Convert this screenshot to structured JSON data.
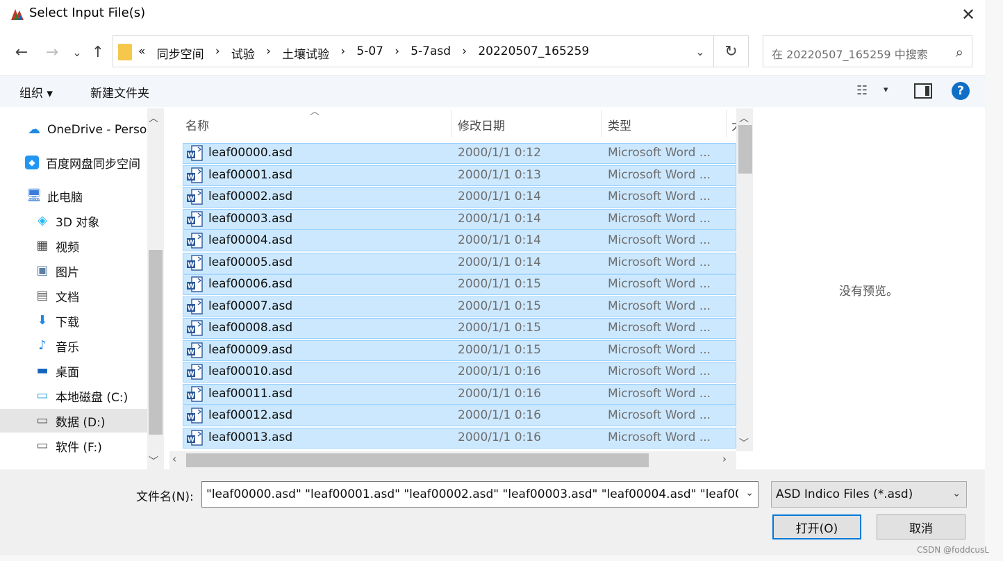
{
  "window": {
    "title": "Select Input File(s)",
    "close": "✕"
  },
  "nav": {
    "back": "←",
    "forward": "→",
    "recent": "⌄",
    "up": "↑",
    "crumb_more": "«",
    "breadcrumbs": [
      "同步空间",
      "试验",
      "土壤试验",
      "5-07",
      "5-7asd",
      "20220507_165259"
    ],
    "separator": "›",
    "refresh": "↻",
    "search_placeholder": "在 20220507_165259 中搜索"
  },
  "toolbar": {
    "organize": "组织 ▾",
    "new_folder": "新建文件夹",
    "view_dd": "▾",
    "help": "?"
  },
  "sidebar": {
    "items": [
      {
        "label": "OneDrive - Perso",
        "icon": "cloud-icon"
      },
      {
        "label": "百度网盘同步空间",
        "icon": "baidu-sync-icon"
      },
      {
        "label": "此电脑",
        "icon": "computer-icon"
      },
      {
        "label": "3D 对象",
        "icon": "cube-icon"
      },
      {
        "label": "视频",
        "icon": "video-icon"
      },
      {
        "label": "图片",
        "icon": "picture-icon"
      },
      {
        "label": "文档",
        "icon": "document-icon"
      },
      {
        "label": "下载",
        "icon": "download-icon"
      },
      {
        "label": "音乐",
        "icon": "music-icon"
      },
      {
        "label": "桌面",
        "icon": "desktop-icon"
      },
      {
        "label": "本地磁盘 (C:)",
        "icon": "drive-c-icon"
      },
      {
        "label": "数据 (D:)",
        "icon": "drive-icon"
      },
      {
        "label": "软件 (F:)",
        "icon": "drive-icon"
      }
    ],
    "selected_index": 11
  },
  "columns": {
    "name": "名称",
    "date": "修改日期",
    "type": "类型",
    "size": "大"
  },
  "files": [
    {
      "name": "leaf00000.asd",
      "date": "2000/1/1 0:12",
      "type": "Microsoft Word ..."
    },
    {
      "name": "leaf00001.asd",
      "date": "2000/1/1 0:13",
      "type": "Microsoft Word ..."
    },
    {
      "name": "leaf00002.asd",
      "date": "2000/1/1 0:14",
      "type": "Microsoft Word ..."
    },
    {
      "name": "leaf00003.asd",
      "date": "2000/1/1 0:14",
      "type": "Microsoft Word ..."
    },
    {
      "name": "leaf00004.asd",
      "date": "2000/1/1 0:14",
      "type": "Microsoft Word ..."
    },
    {
      "name": "leaf00005.asd",
      "date": "2000/1/1 0:14",
      "type": "Microsoft Word ..."
    },
    {
      "name": "leaf00006.asd",
      "date": "2000/1/1 0:15",
      "type": "Microsoft Word ..."
    },
    {
      "name": "leaf00007.asd",
      "date": "2000/1/1 0:15",
      "type": "Microsoft Word ..."
    },
    {
      "name": "leaf00008.asd",
      "date": "2000/1/1 0:15",
      "type": "Microsoft Word ..."
    },
    {
      "name": "leaf00009.asd",
      "date": "2000/1/1 0:15",
      "type": "Microsoft Word ..."
    },
    {
      "name": "leaf00010.asd",
      "date": "2000/1/1 0:16",
      "type": "Microsoft Word ..."
    },
    {
      "name": "leaf00011.asd",
      "date": "2000/1/1 0:16",
      "type": "Microsoft Word ..."
    },
    {
      "name": "leaf00012.asd",
      "date": "2000/1/1 0:16",
      "type": "Microsoft Word ..."
    },
    {
      "name": "leaf00013.asd",
      "date": "2000/1/1 0:16",
      "type": "Microsoft Word ..."
    }
  ],
  "preview": {
    "empty_text": "没有预览。"
  },
  "footer": {
    "filename_label": "文件名(N):",
    "filename_value": "\"leaf00000.asd\" \"leaf00001.asd\" \"leaf00002.asd\" \"leaf00003.asd\" \"leaf00004.asd\" \"leaf00",
    "filetype_value": "ASD Indico Files (*.asd)",
    "open_label": "打开(O)",
    "cancel_label": "取消",
    "dropdown_glyph": "⌄"
  },
  "watermark": "CSDN @foddcusL",
  "colors": {
    "selection_bg": "#cce8ff",
    "selection_border": "#99d1ff",
    "accent": "#0078d7",
    "help_blue": "#0f6fc6"
  }
}
